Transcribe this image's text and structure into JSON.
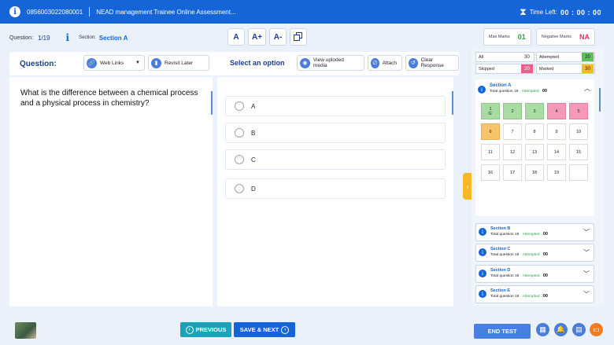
{
  "topbar": {
    "id": "0856003022080001",
    "title": "NEAD management Trainee Online Assessment...",
    "timer_label": "Time Left:",
    "timer_value": "00 : 00 : 00"
  },
  "inforow": {
    "question_label": "Question:",
    "question_count": "1/19",
    "info_glyph": "i",
    "section_label": "Section:",
    "section_name": "Section A",
    "font_buttons": [
      "A",
      "A+",
      "A-"
    ],
    "max_marks_label": "Max Marks",
    "max_marks_value": "01",
    "neg_marks_label": "Negative Marks",
    "neg_marks_value": "NA"
  },
  "toolbar": {
    "question_heading": "Question:",
    "web_links": "Web Links",
    "revisit_later": "Revisit Later",
    "select_option": "Select an option",
    "view_media": "View uploded media",
    "attach": "Attach",
    "clear_response": "Clear Response"
  },
  "question": {
    "text": "What is the difference between a chemical process and a physical process in chemistry?"
  },
  "options": [
    "A",
    "B",
    "C",
    "D"
  ],
  "palette": {
    "legend": [
      {
        "label": "All",
        "count": "30",
        "color": "#ffffff"
      },
      {
        "label": "Attempted",
        "count": "20",
        "color": "#5cc15a"
      },
      {
        "label": "Skipped",
        "count": "20",
        "color": "#ef5d8c"
      },
      {
        "label": "Marked",
        "count": "30",
        "color": "#f6b826"
      }
    ],
    "section_a": {
      "title": "Section A",
      "total_label": "Total question",
      "total_value": "19",
      "attempted_label": "Attempted",
      "attempted_value": "00"
    },
    "cells": [
      {
        "n": "1",
        "extra": "G'",
        "status": "green"
      },
      {
        "n": "2",
        "status": "green"
      },
      {
        "n": "3",
        "status": "green"
      },
      {
        "n": "4",
        "status": "pink"
      },
      {
        "n": "5",
        "status": "pink"
      },
      {
        "n": "6",
        "status": "orange"
      },
      {
        "n": "7",
        "status": "none"
      },
      {
        "n": "8",
        "status": "none"
      },
      {
        "n": "9",
        "status": "none"
      },
      {
        "n": "10",
        "status": "none"
      },
      {
        "n": "11",
        "status": "none"
      },
      {
        "n": "12",
        "status": "none"
      },
      {
        "n": "13",
        "status": "none"
      },
      {
        "n": "14",
        "status": "none"
      },
      {
        "n": "15",
        "status": "none"
      },
      {
        "n": "16",
        "status": "none"
      },
      {
        "n": "17",
        "status": "none"
      },
      {
        "n": "18",
        "status": "none"
      },
      {
        "n": "19",
        "status": "none"
      },
      {
        "n": "",
        "status": "none"
      }
    ],
    "sections": [
      {
        "title": "Section B",
        "total_label": "Total question",
        "total_value": "19",
        "attempted_label": "Attempted",
        "attempted_value": "00"
      },
      {
        "title": "Section C",
        "total_label": "Total question",
        "total_value": "19",
        "attempted_label": "Attempted",
        "attempted_value": "00"
      },
      {
        "title": "Section D",
        "total_label": "Total question",
        "total_value": "19",
        "attempted_label": "Attempted",
        "attempted_value": "00"
      },
      {
        "title": "Section E",
        "total_label": "Total question",
        "total_value": "19",
        "attempted_label": "Attempted",
        "attempted_value": "00"
      }
    ]
  },
  "bottom": {
    "previous": "PREVIOUS",
    "save_next": "SAVE & NEXT",
    "end_test": "END TEST"
  },
  "icons": {
    "info": "info-icon",
    "hourglass": "hourglass-icon",
    "link": "link-icon",
    "bookmark": "bookmark-icon",
    "eye": "eye-icon",
    "attach": "paperclip-icon",
    "clear": "undo-icon",
    "chevron": "chevron-icon"
  }
}
